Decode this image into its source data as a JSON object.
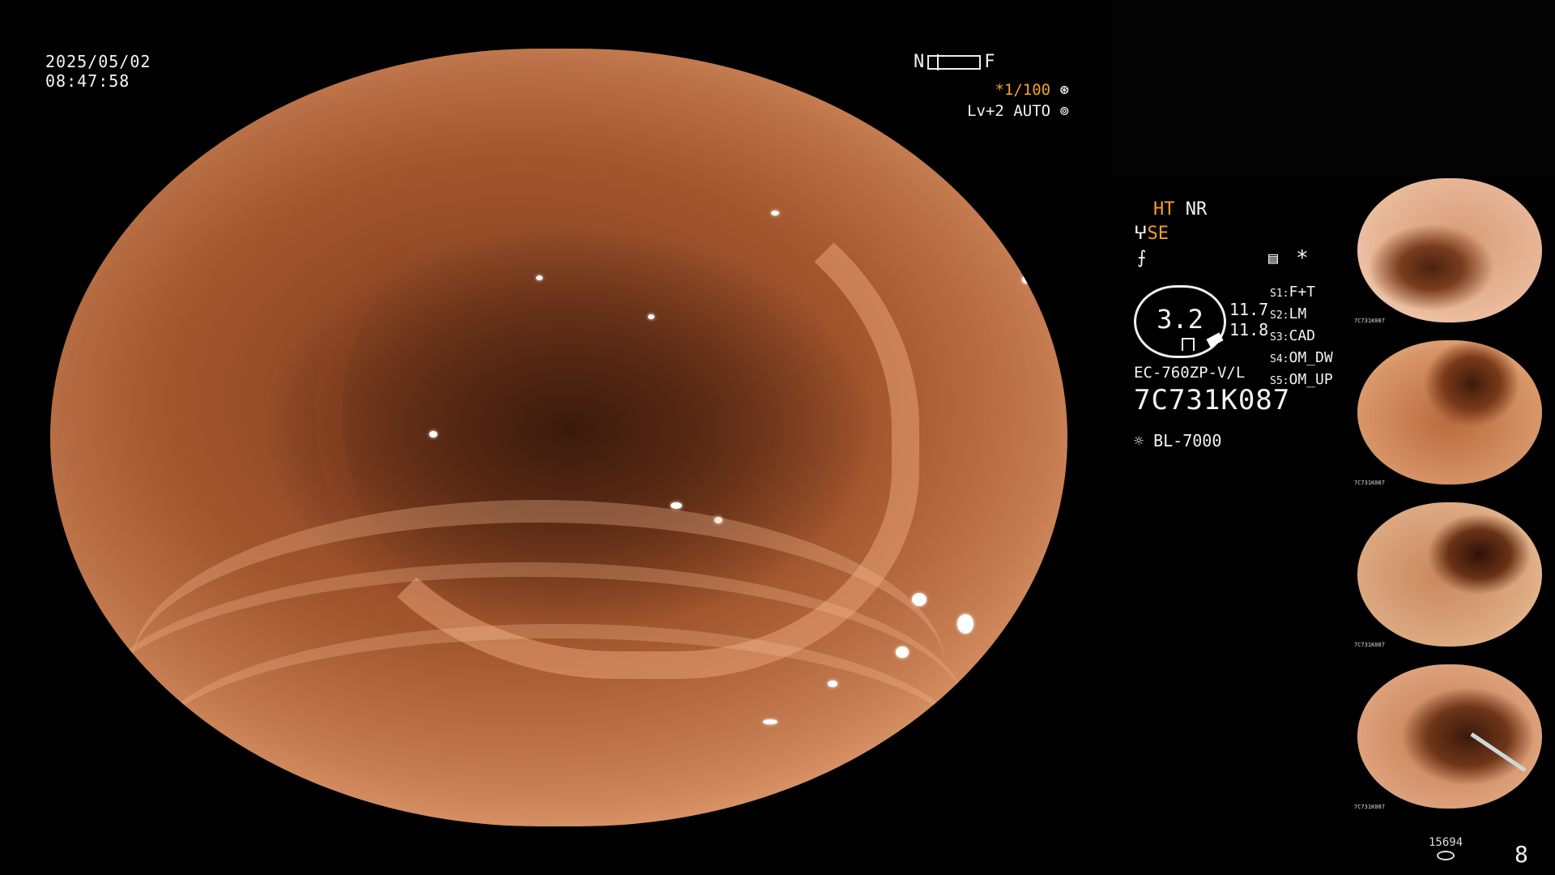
{
  "overlay": {
    "date": "2025/05/02",
    "time": "08:47:58",
    "nf_left": "N",
    "nf_right": "F",
    "shutter": "*1/100",
    "shutter_icon": "shutter-icon",
    "level": "Lv+2",
    "mode": "AUTO",
    "mode_icon": "iris-icon"
  },
  "panel": {
    "ht": "HT",
    "nr": "NR",
    "se_prefix": "ⵖ",
    "se": "SE",
    "f_symbol": "⨍",
    "memory_icon": "memory-card-icon",
    "asterisk": "*",
    "gauge_value": "3.2",
    "reading_1": "11.7",
    "reading_2": "11.8",
    "switches": [
      {
        "key": "S1:",
        "value": "F+T"
      },
      {
        "key": "S2:",
        "value": "LM"
      },
      {
        "key": "S3:",
        "value": "CAD"
      },
      {
        "key": "S4:",
        "value": "OM_DW"
      },
      {
        "key": "S5:",
        "value": "OM_UP"
      }
    ],
    "scope_model": "EC-760ZP-V/L",
    "serial": "7C731K087",
    "light_icon": "light-source-icon",
    "light_source": "BL-7000"
  },
  "thumbnails": [
    {
      "caption": "7C731K087"
    },
    {
      "caption": "7C731K087"
    },
    {
      "caption": "7C731K087"
    },
    {
      "caption": "7C731K087"
    }
  ],
  "footer": {
    "count": "15694",
    "count_icon": "storage-icon",
    "page": "8"
  }
}
